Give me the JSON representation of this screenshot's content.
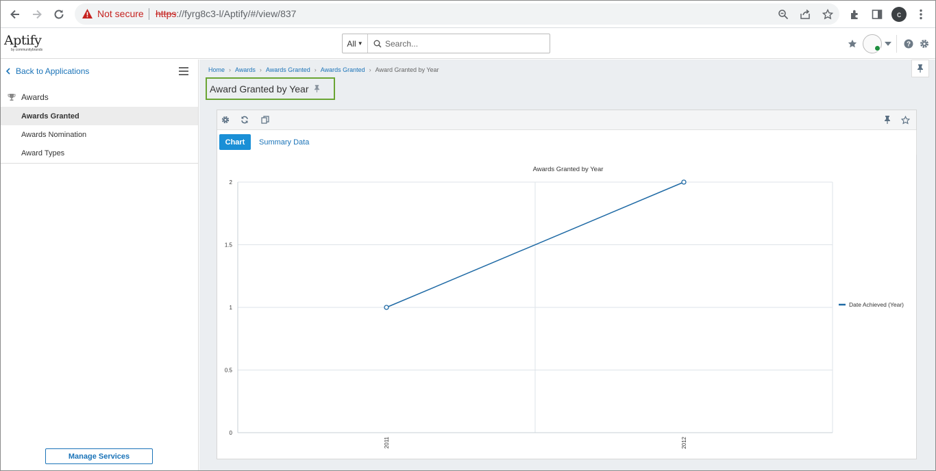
{
  "browser": {
    "not_secure_label": "Not secure",
    "url_scheme": "https",
    "url_rest": "://fyrg8c3-l/Aptify/#/view/837",
    "profile_initial": "c"
  },
  "header": {
    "logo_text": "Aptify",
    "logo_sub": "by communitybrands",
    "search_scope": "All",
    "search_placeholder": "Search..."
  },
  "sidebar": {
    "back_label": "Back to Applications",
    "section_label": "Awards",
    "items": [
      {
        "label": "Awards Granted",
        "active": true
      },
      {
        "label": "Awards Nomination",
        "active": false
      },
      {
        "label": "Award Types",
        "active": false
      }
    ],
    "manage_services_label": "Manage Services"
  },
  "main": {
    "breadcrumb": [
      "Home",
      "Awards",
      "Awards Granted",
      "Awards Granted",
      "Award Granted by Year"
    ],
    "page_title": "Award Granted by Year",
    "tabs": {
      "chart_label": "Chart",
      "summary_label": "Summary Data"
    }
  },
  "chart_data": {
    "type": "line",
    "title": "Awards Granted by Year",
    "categories": [
      "2011",
      "2012"
    ],
    "series": [
      {
        "name": "Date Achieved (Year)",
        "values": [
          1,
          2
        ],
        "color": "#1f6aa5"
      }
    ],
    "yticks": [
      "0",
      "0.5",
      "1",
      "1.5",
      "2"
    ],
    "ylim": [
      0,
      2
    ],
    "grid": true,
    "legend": "right"
  }
}
